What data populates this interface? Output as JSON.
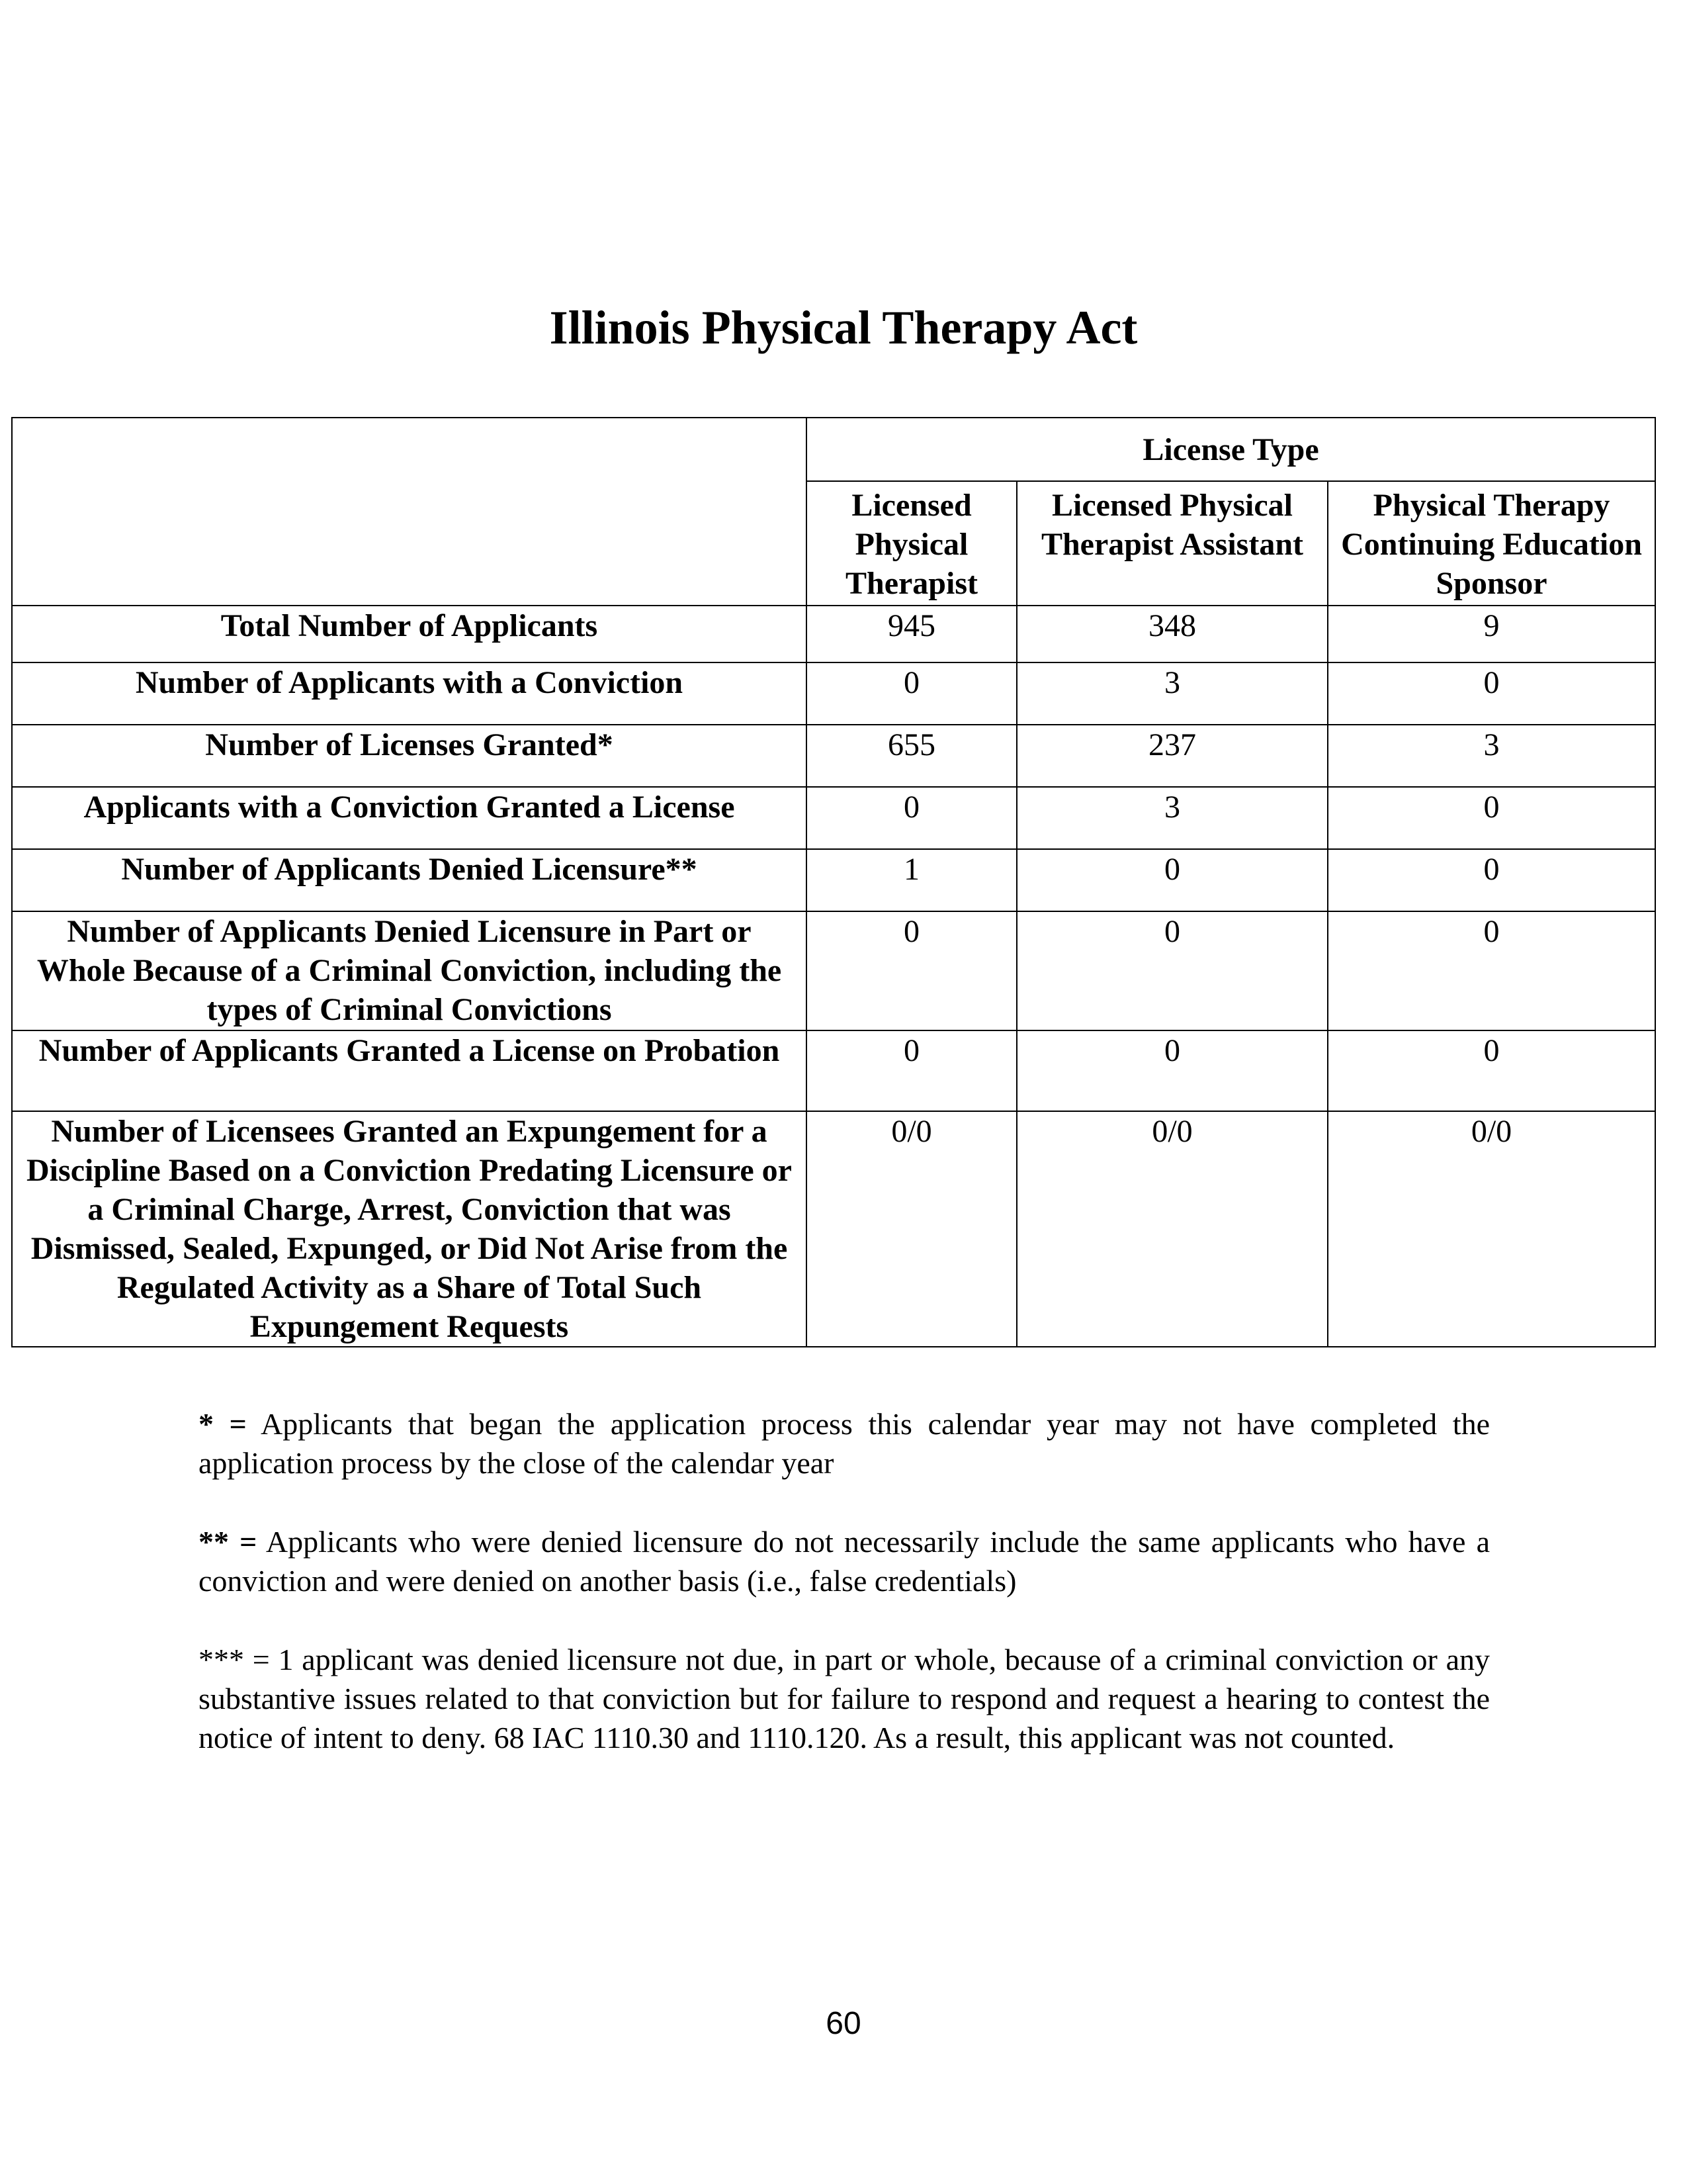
{
  "title": "Illinois Physical Therapy Act",
  "table": {
    "group_header": "License Type",
    "columns": [
      "Licensed Physical Therapist",
      "Licensed Physical Therapist Assistant",
      "Physical Therapy Continuing Education Sponsor"
    ],
    "rows": [
      {
        "label": "Total Number of Applicants",
        "values": [
          "945",
          "348",
          "9"
        ]
      },
      {
        "label": "Number of Applicants with a Conviction",
        "values": [
          "0",
          "3",
          "0"
        ]
      },
      {
        "label": "Number of Licenses Granted*",
        "values": [
          "655",
          "237",
          "3"
        ]
      },
      {
        "label": "Applicants with a Conviction Granted a License",
        "values": [
          "0",
          "3",
          "0"
        ]
      },
      {
        "label": "Number of Applicants Denied Licensure**",
        "values": [
          "1",
          "0",
          "0"
        ]
      },
      {
        "label": "Number of Applicants Denied Licensure in Part or Whole Because of a Criminal Conviction, including the types of Criminal Convictions",
        "values": [
          "0",
          "0",
          "0"
        ]
      },
      {
        "label": "Number of Applicants Granted a License on Probation",
        "values": [
          "0",
          "0",
          "0"
        ]
      },
      {
        "label": "Number of Licensees Granted an Expungement for a Discipline Based on a Conviction Predating Licensure or a Criminal Charge, Arrest, Conviction that was Dismissed, Sealed, Expunged, or Did Not Arise from the Regulated Activity as a Share of Total Such Expungement Requests",
        "values": [
          "0/0",
          "0/0",
          "0/0"
        ]
      }
    ]
  },
  "footnotes": [
    {
      "mark": "* =",
      "text": " Applicants that began the application process this calendar year may not have completed the application process by the close of the calendar year"
    },
    {
      "mark": "** =",
      "text": " Applicants who were denied licensure do not necessarily include the same applicants who have a conviction and were denied on another basis (i.e., false credentials)"
    },
    {
      "mark": "",
      "text": "*** = 1 applicant was denied licensure not due, in part or whole, because of a criminal conviction or any substantive issues related to that conviction but for failure to respond and request a hearing to contest the notice of intent to deny. 68 IAC 1110.30 and 1110.120. As a result, this applicant was not counted."
    }
  ],
  "page_number": "60"
}
